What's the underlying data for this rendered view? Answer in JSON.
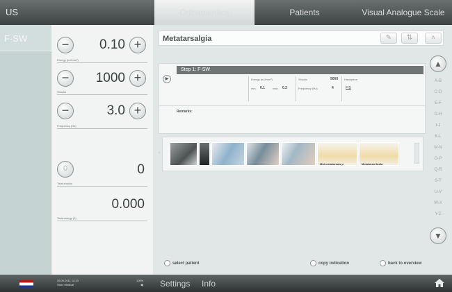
{
  "topbar": {
    "left_label": "US",
    "tabs": [
      {
        "label": "Orthopaedics",
        "active": true
      },
      {
        "label": "Patients",
        "active": false
      },
      {
        "label": "Visual Analogue Scale",
        "active": false
      }
    ]
  },
  "left": {
    "mode_label": "F-SW"
  },
  "params": {
    "energy": {
      "value": "0.10",
      "label": "Energy (mJ/mm²)"
    },
    "shocks": {
      "value": "1000",
      "label": "Shocks"
    },
    "frequency": {
      "value": "3.0",
      "label": "Frequency (Hz)"
    },
    "total_shocks": {
      "value": "0",
      "label": "Total shocks"
    },
    "total_energy": {
      "value": "0.000",
      "label": "Total energy (J)"
    }
  },
  "main": {
    "title": "Metatarsalgia",
    "step": {
      "title": "Step 1: F-SW",
      "energy_label": "Energy (mJ/mm²)",
      "min_label": "min.",
      "min_value": "0.1",
      "max_label": "max.",
      "max_value": "0.2",
      "shocks_label": "Shocks",
      "shocks_value": "5000",
      "frequency_label": "Frequency (Hz)",
      "frequency_value": "4",
      "handpiece_label": "Handpiece",
      "handpiece_value": "F/S"
    },
    "remarks_label": "Remarks:",
    "captions": [
      "Mid metatarsals p",
      "Metatarsal bulla"
    ]
  },
  "alphabet": {
    "items": [
      "A-B",
      "C-D",
      "E-F",
      "G-H",
      "I-J",
      "K-L",
      "M-N",
      "O-P",
      "Q-R",
      "S-T",
      "U-V",
      "W-X",
      "Y-Z"
    ],
    "up_icon": "chevron-up-icon",
    "down_icon": "chevron-down-icon"
  },
  "actions": {
    "select_patient": "select patient",
    "copy_indication": "copy indication",
    "back_to_overview": "back to overview"
  },
  "bottombar": {
    "date": "26.05.2011 13:33",
    "user": "Storz Medical",
    "volume": "100%",
    "settings": "Settings",
    "info": "Info"
  },
  "colors": {
    "topbar": "#3d4242",
    "active_tab": "#e8ebeb",
    "step_header": "#6f7575"
  }
}
